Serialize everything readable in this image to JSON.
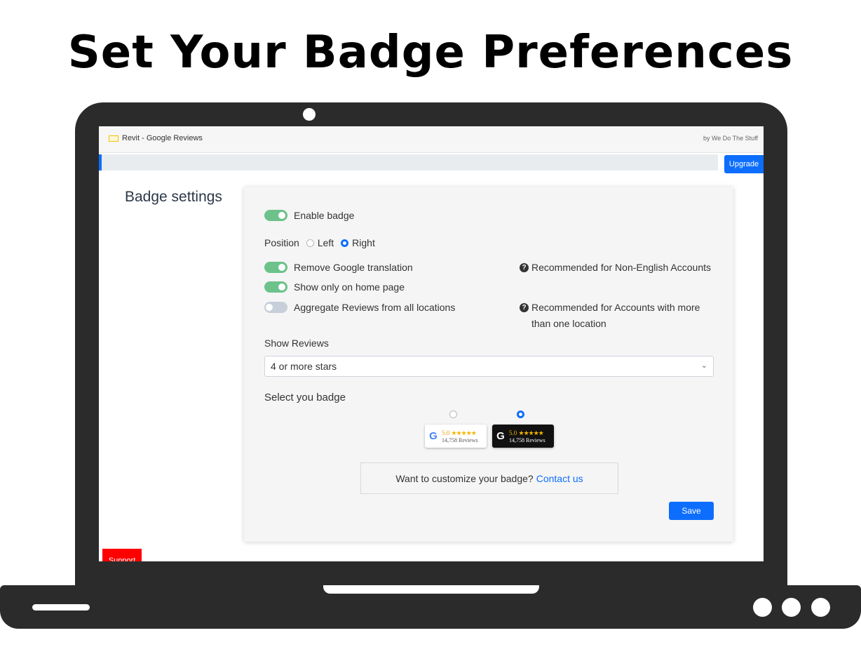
{
  "headline": "Set Your Badge Preferences",
  "app": {
    "title": "Revit - Google Reviews",
    "by": "by We Do The Stuff",
    "upgrade_label": "Upgrade",
    "support_label": "Support"
  },
  "settings": {
    "section_title": "Badge settings",
    "enable_badge": {
      "label": "Enable badge",
      "checked": true
    },
    "position": {
      "label": "Position",
      "options": [
        "Left",
        "Right"
      ],
      "selected": "Right"
    },
    "remove_translation": {
      "label": "Remove Google translation",
      "checked": true
    },
    "home_only": {
      "label": "Show only on home page",
      "checked": true
    },
    "aggregate": {
      "label": "Aggregate Reviews from all locations",
      "checked": false
    },
    "note_translation": "Recommended for Non-English Accounts",
    "note_aggregate_1": "Recommended for Accounts with more",
    "note_aggregate_2": "than one location",
    "show_reviews_label": "Show Reviews",
    "show_reviews_value": "4 or more stars",
    "select_badge_label": "Select you badge",
    "badges": [
      {
        "style": "light",
        "rating": "5.0",
        "stars": "★★★★★",
        "reviews": "14,758 Reviews",
        "selected": false
      },
      {
        "style": "dark",
        "rating": "5.0",
        "stars": "★★★★★",
        "reviews": "14,758 Reviews",
        "selected": true
      }
    ],
    "customize_text": "Want to customize your badge?",
    "contact_link": "Contact us",
    "save_label": "Save"
  },
  "colors": {
    "accent": "#0d6efd",
    "toggle_on": "#6cc28a",
    "toggle_off": "#c7cfdb",
    "support": "#ff0000",
    "laptop": "#2b2b2b"
  }
}
